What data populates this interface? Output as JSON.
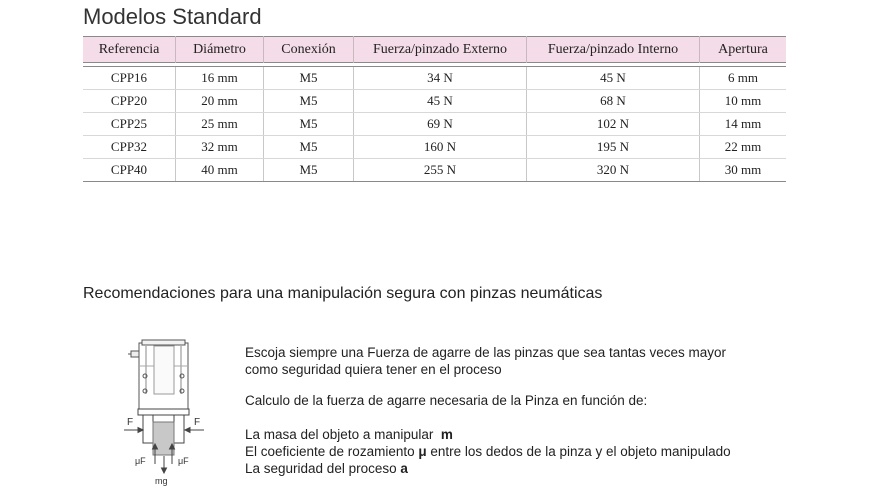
{
  "title": "Modelos Standard",
  "table": {
    "headers": [
      "Referencia",
      "Diámetro",
      "Conexión",
      "Fuerza/pinzado Externo",
      "Fuerza/pinzado Interno",
      "Apertura"
    ],
    "rows": [
      [
        "CPP16",
        "16 mm",
        "M5",
        "34 N",
        "45 N",
        "6 mm"
      ],
      [
        "CPP20",
        "20 mm",
        "M5",
        "45 N",
        "68 N",
        "10 mm"
      ],
      [
        "CPP25",
        "25 mm",
        "M5",
        "69 N",
        "102 N",
        "14 mm"
      ],
      [
        "CPP32",
        "32 mm",
        "M5",
        "160 N",
        "195 N",
        "22 mm"
      ],
      [
        "CPP40",
        "40 mm",
        "M5",
        "255 N",
        "320 N",
        "30 mm"
      ]
    ]
  },
  "section_heading": "Recomendaciones para una manipulación segura con pinzas neumáticas",
  "diagram": {
    "force_left": "F",
    "force_right": "F",
    "friction_left": "μF",
    "friction_right": "μF",
    "weight": "mg"
  },
  "text": {
    "para1_line1": "Escoja siempre una Fuerza de agarre de las pinzas que sea tantas veces mayor",
    "para1_line2": "como seguridad quiera tener en el proceso",
    "para2": "Calculo de la fuerza de agarre necesaria de la Pinza en función de:",
    "line_mass": "La masa del objeto a manipular",
    "line_mass_symbol": "m",
    "line_coef_a": "El coeficiente de rozamiento",
    "line_coef_symbol": "μ",
    "line_coef_b": "entre los dedos de la pinza y el objeto manipulado",
    "line_safety": "La seguridad  del proceso",
    "line_safety_symbol": "a"
  }
}
